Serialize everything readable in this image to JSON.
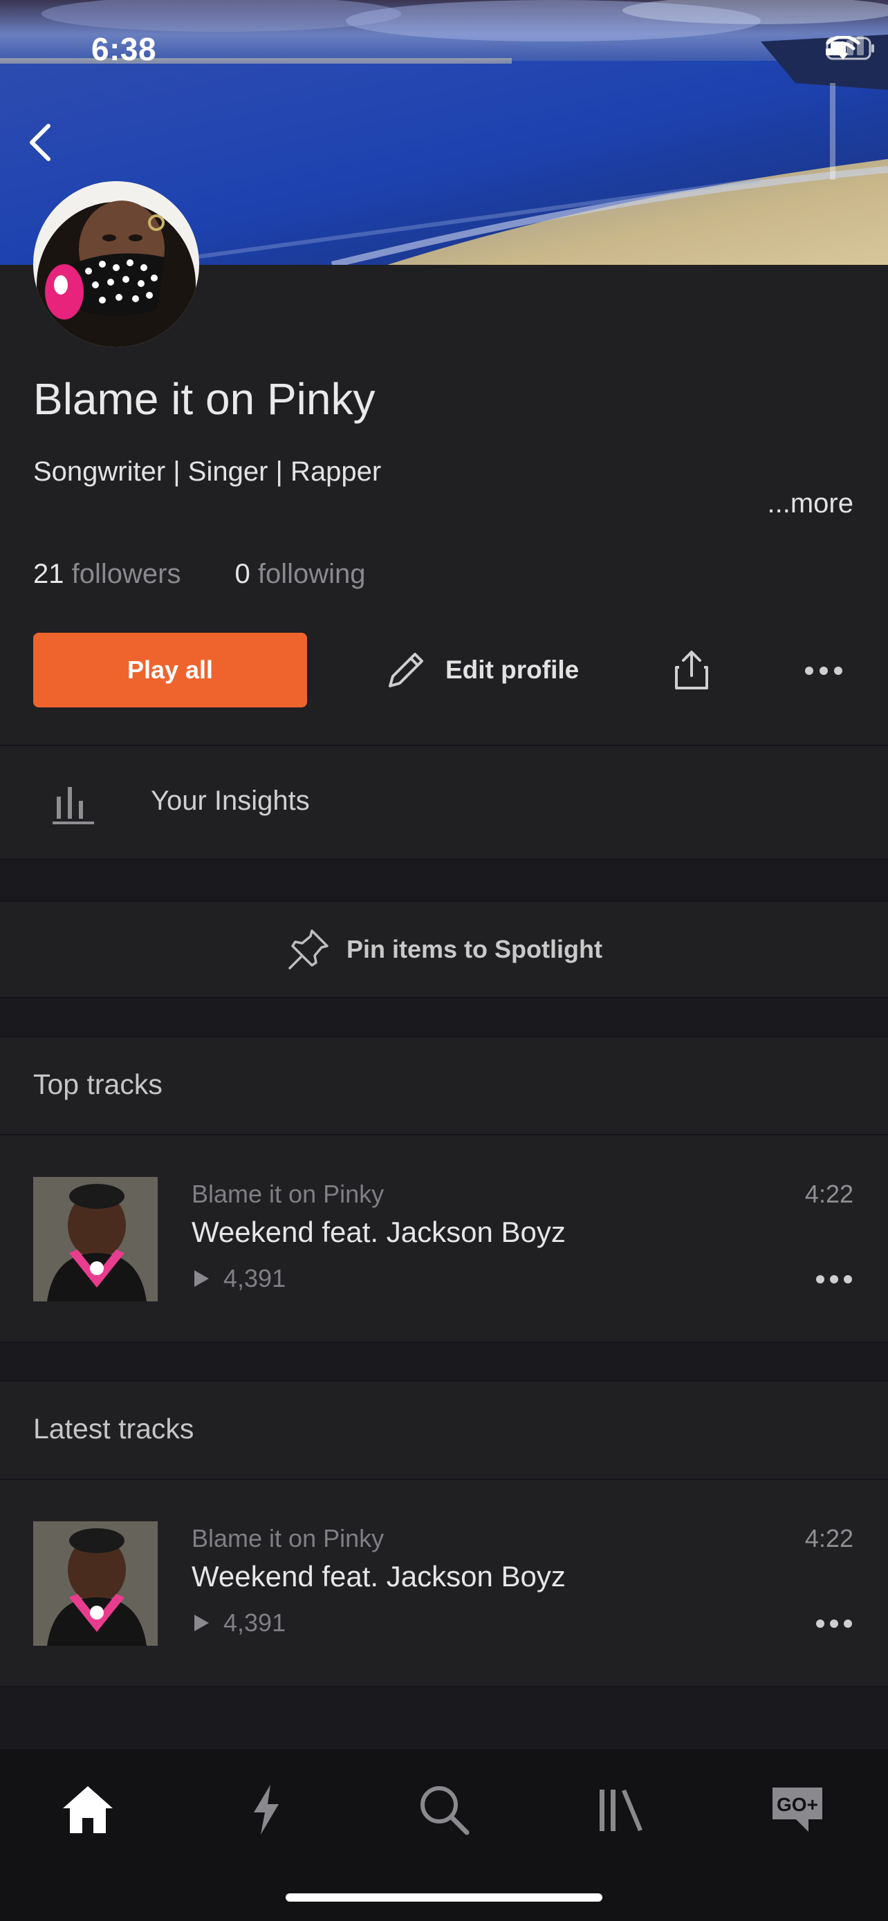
{
  "status_bar": {
    "time": "6:38"
  },
  "profile": {
    "name": "Blame it on Pinky",
    "bio": "Songwriter | Singer | Rapper",
    "more_label": "...more",
    "followers_count": "21",
    "followers_label": "followers",
    "following_count": "0",
    "following_label": "following"
  },
  "actions": {
    "play_all": "Play all",
    "edit_profile": "Edit profile"
  },
  "insights": {
    "label": "Your Insights"
  },
  "spotlight": {
    "label": "Pin items to Spotlight"
  },
  "sections": {
    "top_tracks": {
      "title": "Top tracks",
      "tracks": [
        {
          "artist": "Blame it on Pinky",
          "title": "Weekend feat. Jackson Boyz",
          "plays": "4,391",
          "duration": "4:22"
        }
      ]
    },
    "latest_tracks": {
      "title": "Latest tracks",
      "tracks": [
        {
          "artist": "Blame it on Pinky",
          "title": "Weekend feat. Jackson Boyz",
          "plays": "4,391",
          "duration": "4:22"
        }
      ]
    }
  },
  "bottom_nav": {
    "items": [
      {
        "icon": "home-icon",
        "active": true
      },
      {
        "icon": "lightning-icon",
        "active": false
      },
      {
        "icon": "search-icon",
        "active": false
      },
      {
        "icon": "library-icon",
        "active": false
      },
      {
        "icon": "go-plus-icon",
        "active": false,
        "text": "GO+"
      }
    ]
  },
  "colors": {
    "accent": "#ef642d",
    "background": "#201f22",
    "nav_background": "#121214"
  }
}
